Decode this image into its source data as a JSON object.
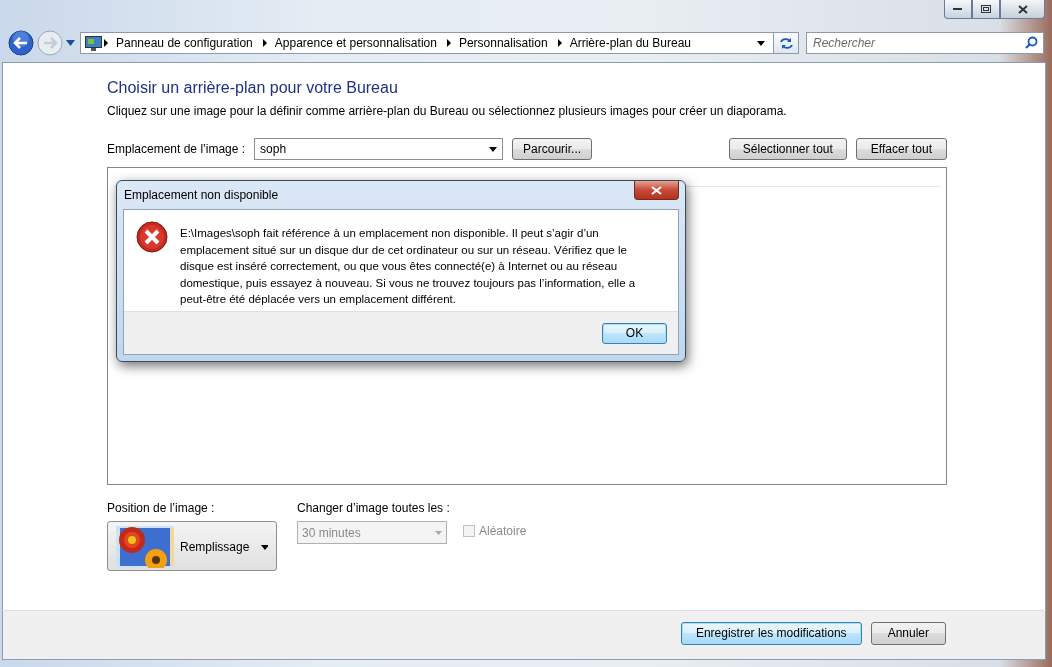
{
  "address_bar": {
    "breadcrumbs": [
      "Panneau de configuration",
      "Apparence et personnalisation",
      "Personnalisation",
      "Arrière-plan du Bureau"
    ]
  },
  "search": {
    "placeholder": "Rechercher"
  },
  "page": {
    "heading": "Choisir un arrière-plan pour votre Bureau",
    "description": "Cliquez sur une image pour la définir comme arrière-plan du Bureau ou sélectionnez plusieurs images pour créer un diaporama.",
    "location": {
      "label": "Emplacement de l’image :",
      "value": "soph"
    },
    "browse_button": "Parcourir...",
    "select_all_button": "Sélectionner tout",
    "clear_all_button": "Effacer tout",
    "position": {
      "label": "Position de l’image :",
      "value": "Remplissage"
    },
    "interval": {
      "label": "Changer d’image toutes les :",
      "value": "30 minutes",
      "disabled": true
    },
    "shuffle": {
      "label": "Aléatoire",
      "checked": false,
      "disabled": true
    }
  },
  "buttons": [
    {
      "label": "Enregistrer les modifications",
      "default": true
    },
    {
      "label": "Annuler",
      "default": false
    }
  ],
  "dialog": {
    "title": "Emplacement non disponible",
    "message": "E:\\Images\\soph fait référence à un emplacement non disponible. Il peut s’agir d’un emplacement situé sur un disque dur de cet ordinateur ou sur un réseau. Vérifiez que le disque est inséré correctement, ou que vous êtes connecté(e) à Internet ou au réseau domestique, puis essayez à nouveau. Si vous ne trouvez toujours pas l’information, elle a peut-être été déplacée vers un emplacement différent.",
    "button": "OK"
  }
}
